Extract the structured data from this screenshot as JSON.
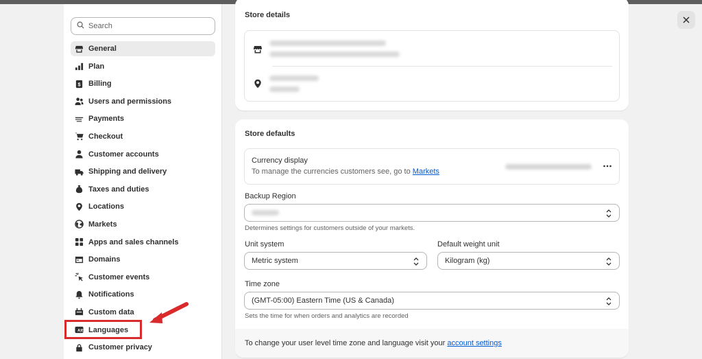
{
  "search": {
    "placeholder": "Search"
  },
  "sidebar": {
    "items": [
      {
        "label": "General",
        "icon": "store-icon"
      },
      {
        "label": "Plan",
        "icon": "plan-icon"
      },
      {
        "label": "Billing",
        "icon": "billing-icon"
      },
      {
        "label": "Users and permissions",
        "icon": "users-icon"
      },
      {
        "label": "Payments",
        "icon": "payments-icon"
      },
      {
        "label": "Checkout",
        "icon": "cart-icon"
      },
      {
        "label": "Customer accounts",
        "icon": "person-icon"
      },
      {
        "label": "Shipping and delivery",
        "icon": "truck-icon"
      },
      {
        "label": "Taxes and duties",
        "icon": "tax-icon"
      },
      {
        "label": "Locations",
        "icon": "location-icon"
      },
      {
        "label": "Markets",
        "icon": "globe-icon"
      },
      {
        "label": "Apps and sales channels",
        "icon": "apps-icon"
      },
      {
        "label": "Domains",
        "icon": "domain-icon"
      },
      {
        "label": "Customer events",
        "icon": "cursor-icon"
      },
      {
        "label": "Notifications",
        "icon": "bell-icon"
      },
      {
        "label": "Custom data",
        "icon": "database-icon"
      },
      {
        "label": "Languages",
        "icon": "language-icon"
      },
      {
        "label": "Customer privacy",
        "icon": "lock-icon"
      }
    ]
  },
  "store_details": {
    "title": "Store details"
  },
  "store_defaults": {
    "title": "Store defaults",
    "currency_title": "Currency display",
    "currency_desc": "To manage the currencies customers see, go to",
    "currency_link": "Markets",
    "backup_region_label": "Backup Region",
    "backup_region_help": "Determines settings for customers outside of your markets.",
    "unit_system_label": "Unit system",
    "unit_system_value": "Metric system",
    "weight_unit_label": "Default weight unit",
    "weight_unit_value": "Kilogram (kg)",
    "time_zone_label": "Time zone",
    "time_zone_value": "(GMT-05:00) Eastern Time (US & Canada)",
    "time_zone_help": "Sets the time for when orders and analytics are recorded",
    "footer_text": "To change your user level time zone and language visit your",
    "footer_link": "account settings"
  },
  "colors": {
    "accent_link": "#005bd3",
    "highlight_red": "#d92b2b"
  }
}
